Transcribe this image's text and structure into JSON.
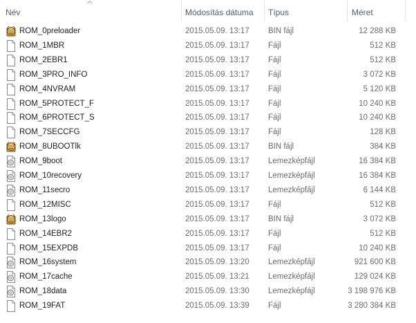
{
  "columns": {
    "name": "Név",
    "date": "Módosítás dátuma",
    "type": "Típus",
    "size": "Méret"
  },
  "files": [
    {
      "name": "ROM_0preloader",
      "date": "2015.05.09. 13:17",
      "type": "BIN fájl",
      "size": "12 288 KB",
      "icon": "bin-app-icon"
    },
    {
      "name": "ROM_1MBR",
      "date": "2015.05.09. 13:17",
      "type": "Fájl",
      "size": "512 KB",
      "icon": "blank-file-icon"
    },
    {
      "name": "ROM_2EBR1",
      "date": "2015.05.09. 13:17",
      "type": "Fájl",
      "size": "512 KB",
      "icon": "blank-file-icon"
    },
    {
      "name": "ROM_3PRO_INFO",
      "date": "2015.05.09. 13:17",
      "type": "Fájl",
      "size": "3 072 KB",
      "icon": "blank-file-icon"
    },
    {
      "name": "ROM_4NVRAM",
      "date": "2015.05.09. 13:17",
      "type": "Fájl",
      "size": "5 120 KB",
      "icon": "blank-file-icon"
    },
    {
      "name": "ROM_5PROTECT_F",
      "date": "2015.05.09. 13:17",
      "type": "Fájl",
      "size": "10 240 KB",
      "icon": "blank-file-icon"
    },
    {
      "name": "ROM_6PROTECT_S",
      "date": "2015.05.09. 13:17",
      "type": "Fájl",
      "size": "10 240 KB",
      "icon": "blank-file-icon"
    },
    {
      "name": "ROM_7SECCFG",
      "date": "2015.05.09. 13:17",
      "type": "Fájl",
      "size": "128 KB",
      "icon": "blank-file-icon"
    },
    {
      "name": "ROM_8UBOOTlk",
      "date": "2015.05.09. 13:17",
      "type": "BIN fájl",
      "size": "384 KB",
      "icon": "bin-app-icon"
    },
    {
      "name": "ROM_9boot",
      "date": "2015.05.09. 13:17",
      "type": "Lemezképfájl",
      "size": "16 384 KB",
      "icon": "disk-image-icon"
    },
    {
      "name": "ROM_10recovery",
      "date": "2015.05.09. 13:17",
      "type": "Lemezképfájl",
      "size": "16 384 KB",
      "icon": "disk-image-icon"
    },
    {
      "name": "ROM_11secro",
      "date": "2015.05.09. 13:17",
      "type": "Lemezképfájl",
      "size": "6 144 KB",
      "icon": "disk-image-icon"
    },
    {
      "name": "ROM_12MISC",
      "date": "2015.05.09. 13:17",
      "type": "Fájl",
      "size": "512 KB",
      "icon": "blank-file-icon"
    },
    {
      "name": "ROM_13logo",
      "date": "2015.05.09. 13:17",
      "type": "BIN fájl",
      "size": "3 072 KB",
      "icon": "bin-app-icon"
    },
    {
      "name": "ROM_14EBR2",
      "date": "2015.05.09. 13:17",
      "type": "Fájl",
      "size": "512 KB",
      "icon": "blank-file-icon"
    },
    {
      "name": "ROM_15EXPDB",
      "date": "2015.05.09. 13:17",
      "type": "Fájl",
      "size": "10 240 KB",
      "icon": "blank-file-icon"
    },
    {
      "name": "ROM_16system",
      "date": "2015.05.09. 13:20",
      "type": "Lemezképfájl",
      "size": "921 600 KB",
      "icon": "disk-image-icon"
    },
    {
      "name": "ROM_17cache",
      "date": "2015.05.09. 13:21",
      "type": "Lemezképfájl",
      "size": "129 024 KB",
      "icon": "disk-image-icon"
    },
    {
      "name": "ROM_18data",
      "date": "2015.05.09. 13:30",
      "type": "Lemezképfájl",
      "size": "3 198 976 KB",
      "icon": "disk-image-icon"
    },
    {
      "name": "ROM_19FAT",
      "date": "2015.05.09. 13:39",
      "type": "Fájl",
      "size": "3 280 384 KB",
      "icon": "blank-file-icon"
    }
  ]
}
